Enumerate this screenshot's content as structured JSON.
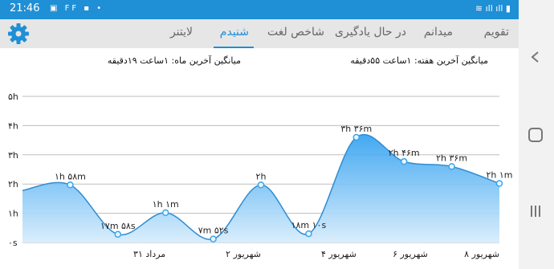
{
  "status_bar": {
    "time": "21:46",
    "left_icons": "▣ FF ▪ •",
    "right_icons": "≋ ıll ıll ▮"
  },
  "tabs": [
    {
      "label": "تقویم",
      "active": false
    },
    {
      "label": "میدانم",
      "active": false
    },
    {
      "label": "در حال یادگیری",
      "active": false
    },
    {
      "label": "شاخص لغت",
      "active": false
    },
    {
      "label": "شنیدم",
      "active": true
    },
    {
      "label": "لایتنر",
      "active": false
    }
  ],
  "settings_icon": "gear-icon",
  "averages": {
    "month": "میانگین آخرین ماه: ۱ساعت  ۱۹دقیقه",
    "week": "میانگین آخرین هفته: ۱ساعت  ۵۵دقیقه"
  },
  "colors": {
    "accent": "#1f8fd6",
    "fill": "#39a7f2",
    "line": "#2f8dd2"
  },
  "chart_data": {
    "type": "area",
    "x": [
      0,
      1,
      2,
      3,
      4,
      5,
      6,
      7,
      8,
      9,
      10
    ],
    "values": [
      1.78,
      1.97,
      0.28,
      1.02,
      0.12,
      1.97,
      0.3,
      3.6,
      2.77,
      2.6,
      2.02
    ],
    "labels": [
      "",
      "۱h ۵۸m",
      "۱۷m ۵۸s",
      "۱h ۱m",
      "۷m ۵۲s",
      "۲h",
      "۱۸m ۱۰s",
      "۳h ۳۶m",
      "۲h ۴۶m",
      "۲h ۳۶m",
      "۲h ۱m"
    ],
    "xtick_labels": [
      {
        "x": 3,
        "label": "۳۱ مرداد"
      },
      {
        "x": 5,
        "label": "۲ شهریور"
      },
      {
        "x": 7,
        "label": "۴ شهریور"
      },
      {
        "x": 8.5,
        "label": "۶ شهریور"
      },
      {
        "x": 10,
        "label": "۸ شهریور"
      }
    ],
    "yticks": [
      {
        "v": 0,
        "label": "۰s"
      },
      {
        "v": 1,
        "label": "۱h"
      },
      {
        "v": 2,
        "label": "۲h"
      },
      {
        "v": 3,
        "label": "۳h"
      },
      {
        "v": 4,
        "label": "۴h"
      },
      {
        "v": 5,
        "label": "۵h"
      }
    ],
    "ylim": [
      0,
      5
    ],
    "grid": true
  }
}
